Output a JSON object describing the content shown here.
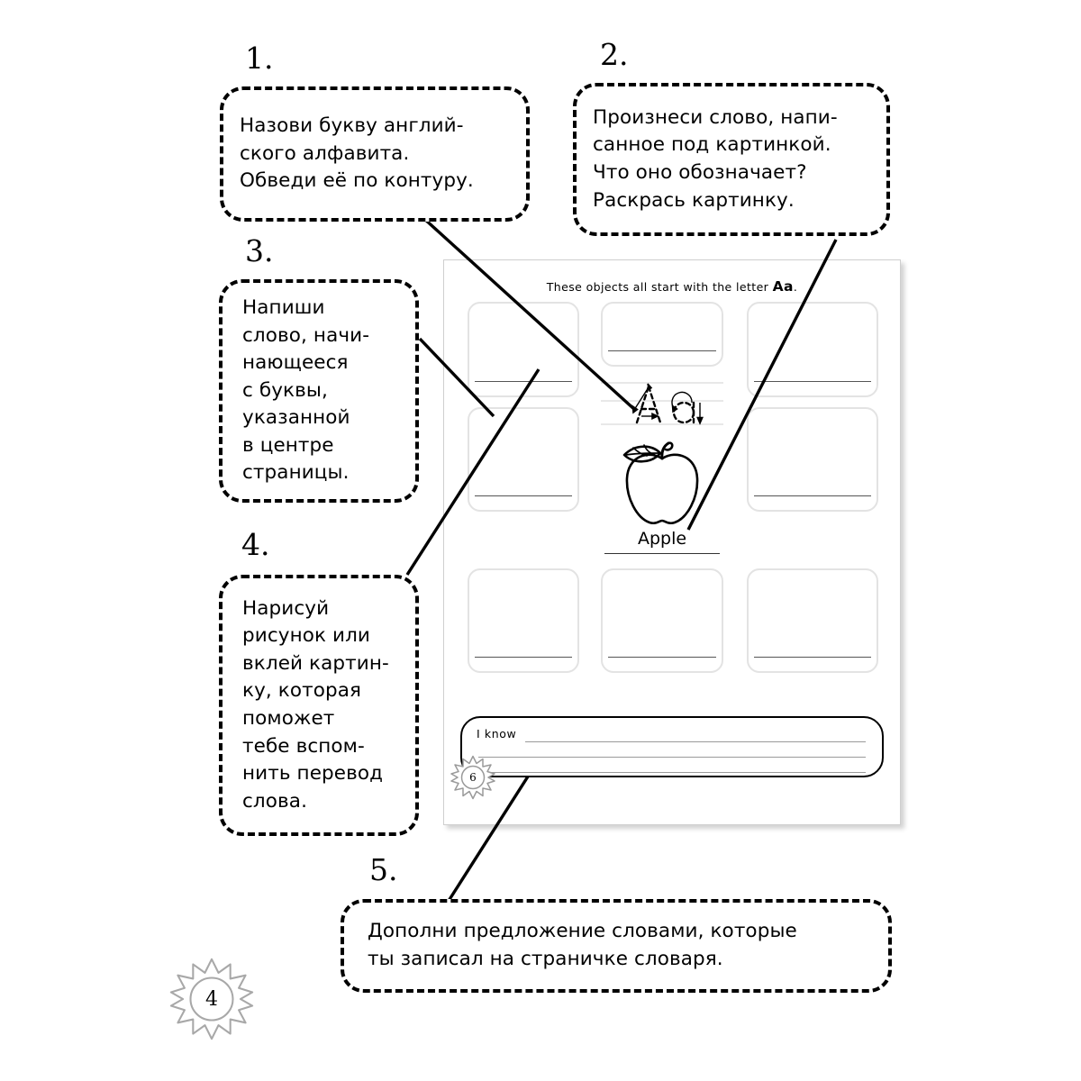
{
  "callouts": [
    {
      "number": "1.",
      "text": "Назови букву англий-\nского алфавита.\nОбведи её по контуру."
    },
    {
      "number": "2.",
      "text": "Произнеси слово, напи-\nсанное под картинкой.\nЧто оно обозначает?\nРаскрась картинку."
    },
    {
      "number": "3.",
      "text": "Напиши\nслово, начи-\nнающееся\nс буквы,\nуказанной\nв центре\nстраницы."
    },
    {
      "number": "4.",
      "text": "Нарисуй\nрисунок или\nвклей картин-\nку, которая\nпоможет\nтебе вспом-\nнить перевод\nслова."
    },
    {
      "number": "5.",
      "text": "Дополни предложение словами, которые\nты записал на страничке словаря."
    }
  ],
  "worksheet": {
    "header_prefix": "These objects all start with the letter ",
    "header_letter": "Aa",
    "header_suffix": ".",
    "trace_letters": "Aa",
    "picture_name": "apple-drawing",
    "picture_word": "Apple",
    "iknow_label": "I know",
    "iknow_line_count": 3,
    "page_number": "6",
    "empty_cells": 8
  },
  "book": {
    "page_number": "4"
  },
  "colors": {
    "ink": "#000000",
    "box_border": "#e3e3e3",
    "write_line": "#555555",
    "rule_line": "#cccccc",
    "sun_outline": "#9a9a9a",
    "page_border": "#cfcfcf",
    "background": "#ffffff"
  }
}
